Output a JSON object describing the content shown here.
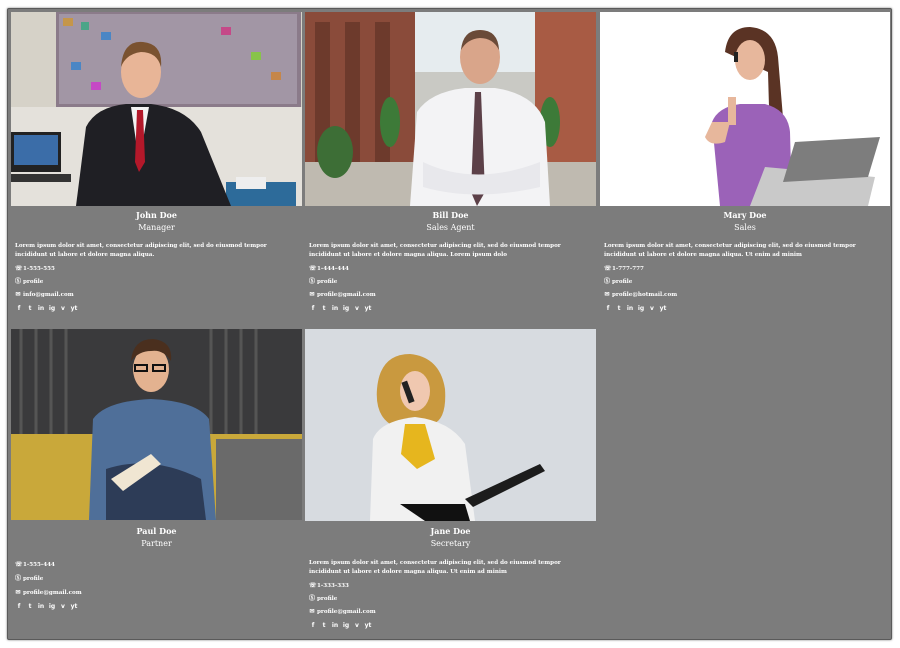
{
  "members": [
    {
      "name": "John Doe",
      "role": "Manager",
      "bio": "Lorem ipsum dolor sit amet, consectetur adipiscing elit, sed do eiusmod tempor incididunt ut labore et dolore magna aliqua.",
      "phone": "1-555-555",
      "skype": "profile",
      "email": "info@gmail.com"
    },
    {
      "name": "Bill Doe",
      "role": "Sales Agent",
      "bio": "Lorem ipsum dolor sit amet, consectetur adipiscing elit, sed do eiusmod tempor incididunt ut labore et dolore magna aliqua. Lorem ipsum dolo",
      "phone": "1-444-444",
      "skype": "profile",
      "email": "profile@gmail.com"
    },
    {
      "name": "Mary Doe",
      "role": "Sales",
      "bio": "Lorem ipsum dolor sit amet, consectetur adipiscing elit, sed do eiusmod tempor incididunt ut labore et dolore magna aliqua. Ut enim ad minim",
      "phone": "1-777-777",
      "skype": "profile",
      "email": "profile@hotmail.com"
    },
    {
      "name": "Paul Doe",
      "role": "Partner",
      "bio": "",
      "phone": "1-555-444",
      "skype": "profile",
      "email": "profile@gmail.com"
    },
    {
      "name": "Jane Doe",
      "role": "Secretary",
      "bio": "Lorem ipsum dolor sit amet, consectetur adipiscing elit, sed do eiusmod tempor incididunt ut labore et dolore magna aliqua. Ut enim ad minim",
      "phone": "1-333-333",
      "skype": "profile",
      "email": "profile@gmail.com"
    }
  ],
  "social_icons": [
    "f",
    "t",
    "in",
    "ig",
    "v",
    "yt"
  ],
  "icons": {
    "phone": "phone-icon",
    "skype": "skype-icon",
    "email": "email-icon"
  },
  "colors": {
    "panel": "#7c7c7c",
    "text": "#ffffff"
  }
}
